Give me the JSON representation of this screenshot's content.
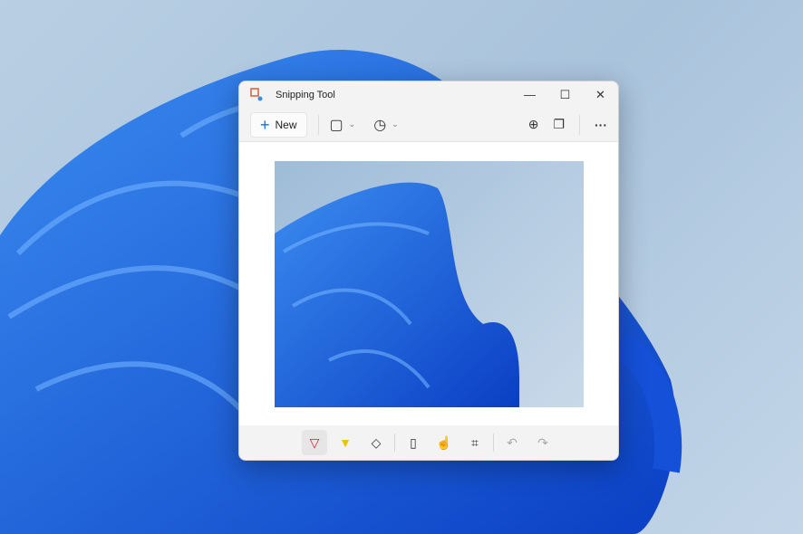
{
  "window": {
    "title": "Snipping Tool",
    "minimize": "—",
    "maximize": "☐",
    "close": "✕"
  },
  "toolbar": {
    "new_label": "New",
    "new_icon": "+",
    "snip_mode_icon": "▢",
    "delay_icon": "◷",
    "chevron": "⌄",
    "zoom_icon": "⊕",
    "copy_icon": "❐",
    "more": "···"
  },
  "bottom": {
    "pen": "▽",
    "highlighter": "▼",
    "eraser": "◇",
    "ruler": "▯",
    "touch": "☝",
    "crop": "⌗",
    "undo": "↶",
    "redo": "↷"
  }
}
